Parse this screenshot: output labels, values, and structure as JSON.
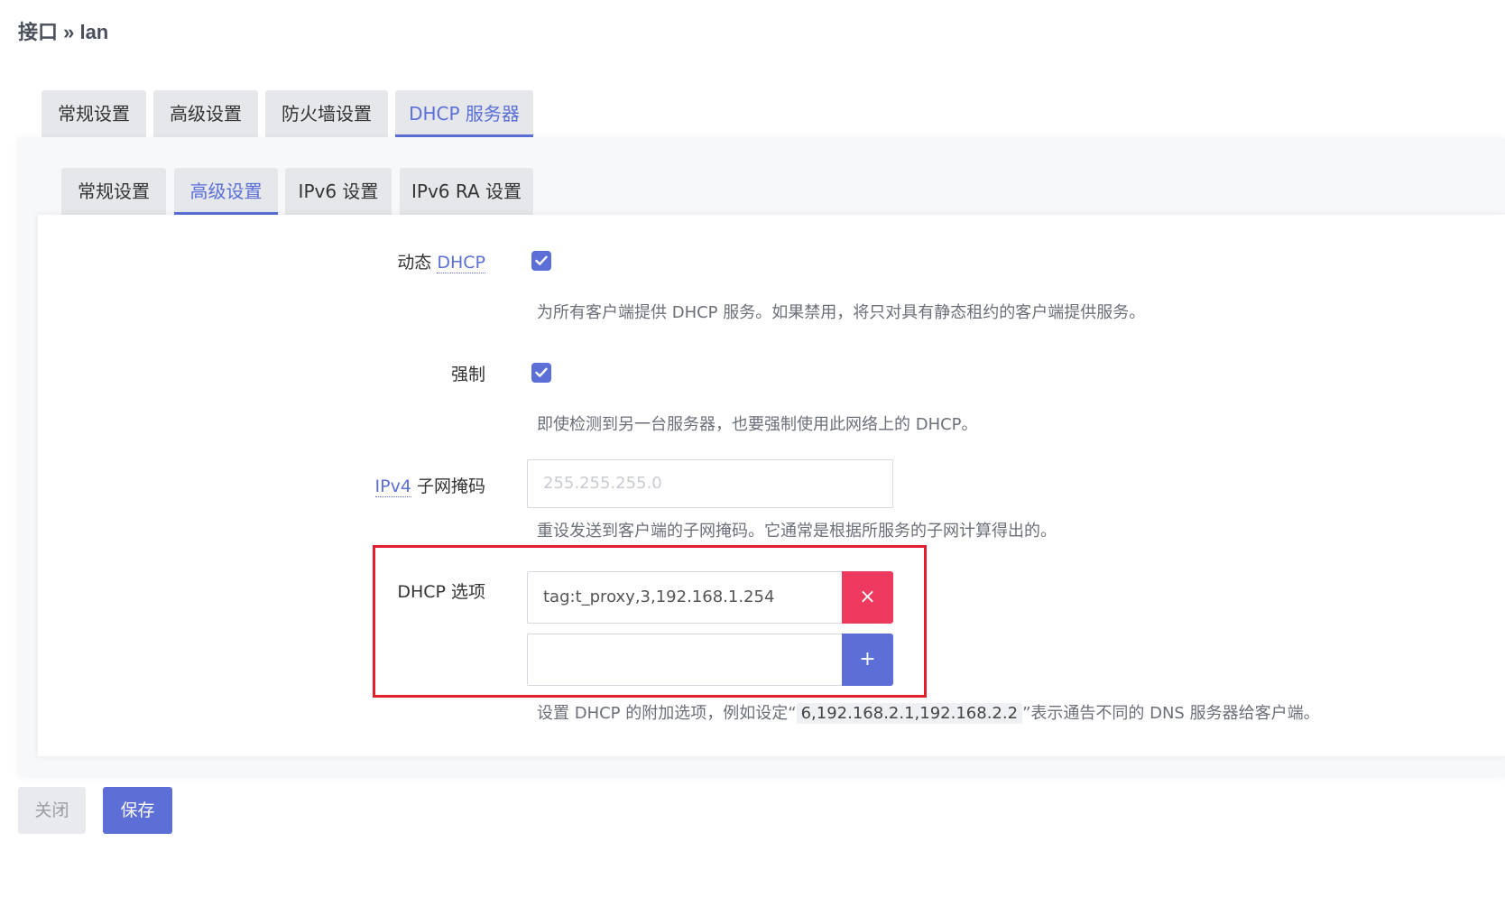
{
  "breadcrumb": "接口 » lan",
  "tabs_main": [
    {
      "label": "常规设置"
    },
    {
      "label": "高级设置"
    },
    {
      "label": "防火墙设置"
    },
    {
      "label": "DHCP 服务器"
    }
  ],
  "tabs_sub": [
    {
      "label": "常规设置"
    },
    {
      "label": "高级设置"
    },
    {
      "label": "IPv6 设置"
    },
    {
      "label": "IPv6 RA 设置"
    }
  ],
  "dynamic_dhcp": {
    "label_prefix": "动态 ",
    "label_abbr": "DHCP",
    "checked": true,
    "desc": "为所有客户端提供 DHCP 服务。如果禁用，将只对具有静态租约的客户端提供服务。"
  },
  "force": {
    "label": "强制",
    "checked": true,
    "desc": "即使检测到另一台服务器，也要强制使用此网络上的 DHCP。"
  },
  "ipv4_netmask": {
    "label_abbr": "IPv4",
    "label_suffix": " 子网掩码",
    "placeholder": "255.255.255.0",
    "value": "",
    "desc": "重设发送到客户端的子网掩码。它通常是根据所服务的子网计算得出的。"
  },
  "dhcp_options": {
    "label": "DHCP 选项",
    "items": [
      {
        "value": "tag:t_proxy,3,192.168.1.254",
        "button": "×"
      }
    ],
    "new_value": "",
    "add_button": "+",
    "desc_before": "设置 DHCP 的附加选项，例如设定“",
    "desc_code": "6,192.168.2.1,192.168.2.2",
    "desc_after": "”表示通告不同的 DNS 服务器给客户端。"
  },
  "footer": {
    "close_label": "关闭",
    "save_label": "保存"
  },
  "colors": {
    "accent": "#5b6fd6",
    "danger": "#ee3a5e",
    "highlight_box": "#e0202a"
  }
}
